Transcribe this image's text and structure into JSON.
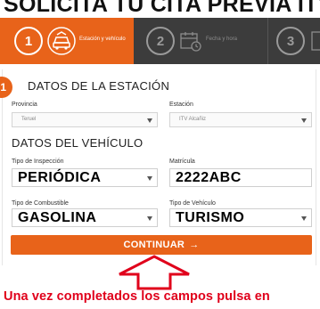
{
  "headline": "SOLICITA TU CITA PREVIA ITV",
  "stepper": {
    "steps": [
      {
        "number": "1",
        "label": "Estación y vehículo",
        "icon": "car-station-icon"
      },
      {
        "number": "2",
        "label": "Fecha y hora",
        "icon": "calendar-icon"
      },
      {
        "number": "3",
        "label": "",
        "icon": ""
      }
    ]
  },
  "station_section": {
    "badge": "1",
    "title": "DATOS DE LA ESTACIÓN",
    "provincia_label": "Provincia",
    "provincia_value": "Teruel",
    "estacion_label": "Estación",
    "estacion_value": "ITV Alcañiz"
  },
  "vehicle_section": {
    "title": "DATOS DEL VEHÍCULO",
    "tipo_inspeccion_label": "Tipo de Inspección",
    "tipo_inspeccion_value": "PERIÓDICA",
    "matricula_label": "Matrícula",
    "matricula_value": "2222ABC",
    "combustible_label": "Tipo de Combustible",
    "combustible_value": "GASOLINA",
    "tipo_vehiculo_label": "Tipo de Vehículo",
    "tipo_vehiculo_value": "TURISMO"
  },
  "continue_button": {
    "label": "CONTINUAR",
    "arrow": "→"
  },
  "caption": "Una vez completados los campos pulsa en",
  "colors": {
    "accent": "#e8631a",
    "stepper_bg": "#3c3c3c",
    "caption": "#e0001b"
  }
}
